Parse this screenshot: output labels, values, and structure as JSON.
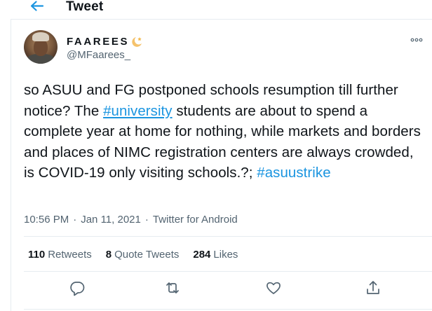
{
  "header": {
    "title": "Tweet",
    "back_icon": "arrow-left-icon"
  },
  "author": {
    "display_name": "FAAREES",
    "handle": "@MFaarees_",
    "badge_icon": "moon-star-icon"
  },
  "tweet": {
    "text_part1": "so ASUU and FG postponed schools resumption till further notice? The ",
    "hashtag1": "#university",
    "text_part2": " students are about to spend a complete year at home for nothing, while markets and borders and places of NIMC registration centers are always crowded, is COVID-19 only visiting schools.?; ",
    "hashtag2": "#asuustrike"
  },
  "meta": {
    "time": "10:56 PM",
    "separator1": "·",
    "date": "Jan 11, 2021",
    "separator2": "·",
    "source": "Twitter for Android"
  },
  "stats": {
    "retweets_count": "110",
    "retweets_label": "Retweets",
    "quotes_count": "8",
    "quotes_label": "Quote Tweets",
    "likes_count": "284",
    "likes_label": "Likes"
  },
  "actions": [
    "reply-icon",
    "retweet-icon",
    "like-icon",
    "share-icon"
  ],
  "colors": {
    "accent": "#1b95e0",
    "text": "#0f1419",
    "muted": "#536471",
    "border": "#e6ecf0"
  }
}
